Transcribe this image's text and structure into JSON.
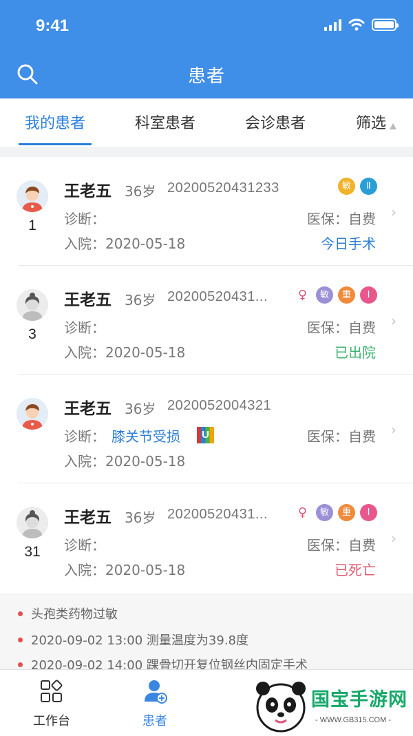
{
  "status_bar": {
    "time": "9:41"
  },
  "header": {
    "title": "患者",
    "search_icon": "search-icon"
  },
  "tabs": [
    {
      "label": "我的患者",
      "active": true
    },
    {
      "label": "科室患者",
      "active": false
    },
    {
      "label": "会诊患者",
      "active": false
    },
    {
      "label": "筛选",
      "active": false
    }
  ],
  "labels": {
    "diagnosis": "诊断：",
    "admission_prefix": "入院：",
    "insurance_prefix": "医保："
  },
  "patients": [
    {
      "name": "王老五",
      "age": "36岁",
      "id": "20200520431233",
      "bed": "1",
      "avatar": "male-doctor-avatar",
      "badges": [
        {
          "text": "敏",
          "color": "#f0b329"
        },
        {
          "text": "Ⅱ",
          "color": "#2a9fd6"
        }
      ],
      "diagnosis": "",
      "insurance": "自费",
      "admission": "2020-05-18",
      "status": "今日手术",
      "status_color": "#2e7fd7"
    },
    {
      "name": "王老五",
      "age": "36岁",
      "id": "20200520431...",
      "bed": "3",
      "avatar": "female-avatar-gray",
      "badges": [
        {
          "text": "♀",
          "color": "#e0567a"
        },
        {
          "text": "敏",
          "color": "#9b8fd6"
        },
        {
          "text": "重",
          "color": "#f08a3c"
        },
        {
          "text": "I",
          "color": "#e8578b"
        }
      ],
      "diagnosis": "",
      "insurance": "自费",
      "admission": "2020-05-18",
      "status": "已出院",
      "status_color": "#3bb36f"
    },
    {
      "name": "王老五",
      "age": "36岁",
      "id": "2020052004321",
      "bed": "",
      "avatar": "male-doctor-avatar",
      "badges": [],
      "diagnosis": "膝关节受损",
      "diagnosis_tag": "U",
      "insurance": "自费",
      "admission": "2020-05-18",
      "status": "",
      "status_color": "#2e7fd7"
    },
    {
      "name": "王老五",
      "age": "36岁",
      "id": "20200520431...",
      "bed": "31",
      "avatar": "female-avatar-gray",
      "badges": [
        {
          "text": "♀",
          "color": "#e0567a"
        },
        {
          "text": "敏",
          "color": "#9b8fd6"
        },
        {
          "text": "重",
          "color": "#f08a3c"
        },
        {
          "text": "I",
          "color": "#e8578b"
        }
      ],
      "diagnosis": "",
      "insurance": "自费",
      "admission": "2020-05-18",
      "status": "已死亡",
      "status_color": "#e05a70"
    }
  ],
  "notes": [
    "头孢类药物过敏",
    "2020-09-02 13:00  测量温度为39.8度",
    "2020-09-02 14:00  踝骨切开复位钢丝内固定手术"
  ],
  "bottom_nav": [
    {
      "label": "工作台",
      "icon": "grid-icon",
      "active": false
    },
    {
      "label": "患者",
      "icon": "patient-add-icon",
      "active": true
    }
  ],
  "watermark": {
    "title": "国宝手游网",
    "url": "- WWW.GB315.COM -"
  },
  "colors": {
    "primary": "#3f8ee8",
    "accent": "#2a7fe0"
  }
}
